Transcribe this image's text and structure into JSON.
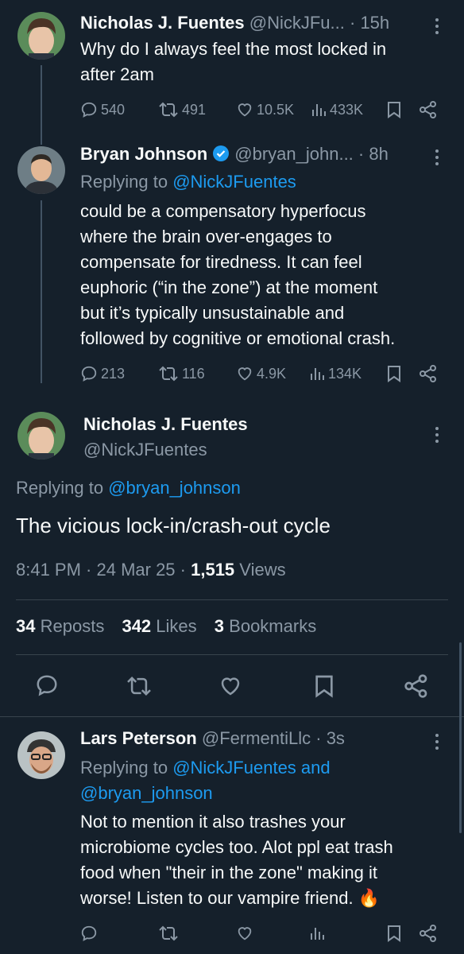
{
  "tweet1": {
    "name": "Nicholas J. Fuentes",
    "handle": "@NickJFu...",
    "time": "· 15h",
    "text_line1": "Why do I always feel the most locked in",
    "text_line2": "after 2am",
    "replies": "540",
    "reposts": "491",
    "likes": "10.5K",
    "views": "433K"
  },
  "tweet2": {
    "name": "Bryan Johnson",
    "handle": "@bryan_john...",
    "time": "· 8h",
    "replying_prefix": "Replying to",
    "replying_to": "@NickJFuentes",
    "lines": [
      "could be a compensatory hyperfocus",
      "where the brain over-engages to",
      "compensate for tiredness. It can feel",
      "euphoric (“in the zone”) at the moment",
      "but it’s typically unsustainable and",
      "followed by cognitive or emotional crash."
    ],
    "replies": "213",
    "reposts": "116",
    "likes": "4.9K",
    "views": "134K"
  },
  "main": {
    "name": "Nicholas J. Fuentes",
    "handle": "@NickJFuentes",
    "replying_prefix": "Replying to",
    "replying_to": "@bryan_johnson",
    "text": "The vicious lock-in/crash-out cycle",
    "time": "8:41 PM · 24 Mar 25 ·",
    "views_count": "1,515",
    "views_label": "Views",
    "reposts_count": "34",
    "reposts_label": "Reposts",
    "likes_count": "342",
    "likes_label": "Likes",
    "bookmarks_count": "3",
    "bookmarks_label": "Bookmarks"
  },
  "reply": {
    "name": "Lars Peterson",
    "handle": "@FermentiLlc",
    "time": "· 3s",
    "replying_prefix": "Replying to",
    "replying_to_line1": "@NickJFuentes and",
    "replying_to_line2": "@bryan_johnson",
    "lines": [
      "Not to mention it also trashes your",
      "microbiome cycles too. Alot ppl eat trash",
      "food when \"their in the zone\" making it",
      "worse! Listen to our vampire friend. 🔥"
    ]
  },
  "colors": {
    "background": "#15202b",
    "text": "#f7f9f9",
    "muted": "#8b98a5",
    "accent": "#1d9bf0"
  }
}
